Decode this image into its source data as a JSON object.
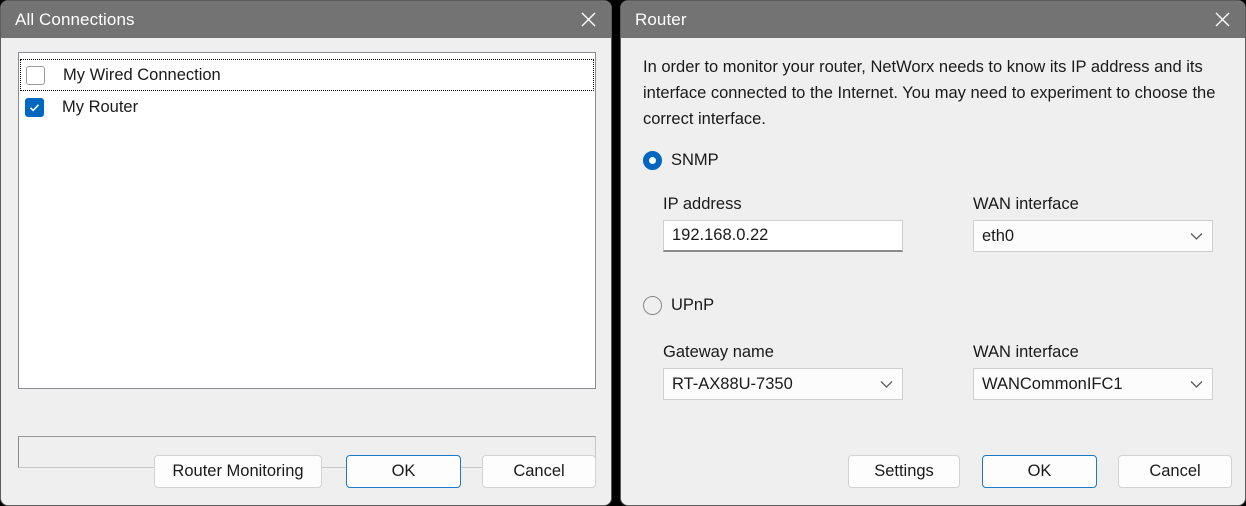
{
  "connections_dialog": {
    "title": "All Connections",
    "close_icon": "close-icon",
    "list": [
      {
        "label": "My Wired Connection",
        "checked": false,
        "focused": true
      },
      {
        "label": "My Router",
        "checked": true,
        "focused": false
      }
    ],
    "status_bar_text": "",
    "buttons": {
      "router_monitoring": "Router Monitoring",
      "ok": "OK",
      "cancel": "Cancel"
    }
  },
  "router_dialog": {
    "title": "Router",
    "close_icon": "close-icon",
    "description": "In order to monitor your router, NetWorx needs to know its IP address and its interface connected to the Internet. You may need to experiment to choose the correct interface.",
    "snmp": {
      "radio_label": "SNMP",
      "selected": true,
      "ip_address_label": "IP address",
      "ip_address_value": "192.168.0.22",
      "wan_interface_label": "WAN interface",
      "wan_interface_value": "eth0"
    },
    "upnp": {
      "radio_label": "UPnP",
      "selected": false,
      "gateway_name_label": "Gateway name",
      "gateway_name_value": "RT-AX88U-7350",
      "wan_interface_label": "WAN interface",
      "wan_interface_value": "WANCommonIFC1"
    },
    "buttons": {
      "settings": "Settings",
      "ok": "OK",
      "cancel": "Cancel"
    }
  },
  "colors": {
    "titlebar": "#737373",
    "dialog_background": "#efefef",
    "accent_blue": "#0067c0",
    "default_button_border": "#1a7ac7",
    "text": "#1a1a1a"
  }
}
